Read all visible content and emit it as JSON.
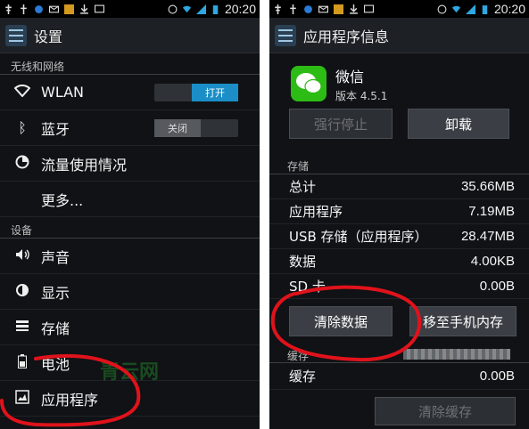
{
  "status_bar": {
    "time": "20:20"
  },
  "left": {
    "title": "设置",
    "section_wireless": "无线和网络",
    "wlan": {
      "label": "WLAN",
      "toggle": "打开"
    },
    "bluetooth": {
      "label": "蓝牙",
      "toggle": "关闭"
    },
    "data_usage": "流量使用情况",
    "more": "更多...",
    "section_device": "设备",
    "sound": "声音",
    "display": "显示",
    "storage": "存储",
    "battery": "电池",
    "apps": "应用程序",
    "watermark": "青云网"
  },
  "right": {
    "title": "应用程序信息",
    "app_name": "微信",
    "app_version": "版本 4.5.1",
    "force_stop": "强行停止",
    "uninstall": "卸载",
    "section_storage": "存储",
    "storage_rows": [
      {
        "label": "总计",
        "value": "35.66MB"
      },
      {
        "label": "应用程序",
        "value": "7.19MB"
      },
      {
        "label": "USB 存储（应用程序）",
        "value": "28.47MB"
      },
      {
        "label": "数据",
        "value": "4.00KB"
      },
      {
        "label": "SD 卡",
        "value": "0.00B"
      }
    ],
    "clear_data": "清除数据",
    "move_to_phone": "移至手机内存",
    "section_cache": "缓存",
    "cache_label": "缓存",
    "cache_value": "0.00B",
    "clear_cache": "清除缓存"
  },
  "colors": {
    "toggle_on": "#1b8ec7",
    "annotation_red": "#e0121b",
    "wechat_green": "#2dbb16"
  }
}
